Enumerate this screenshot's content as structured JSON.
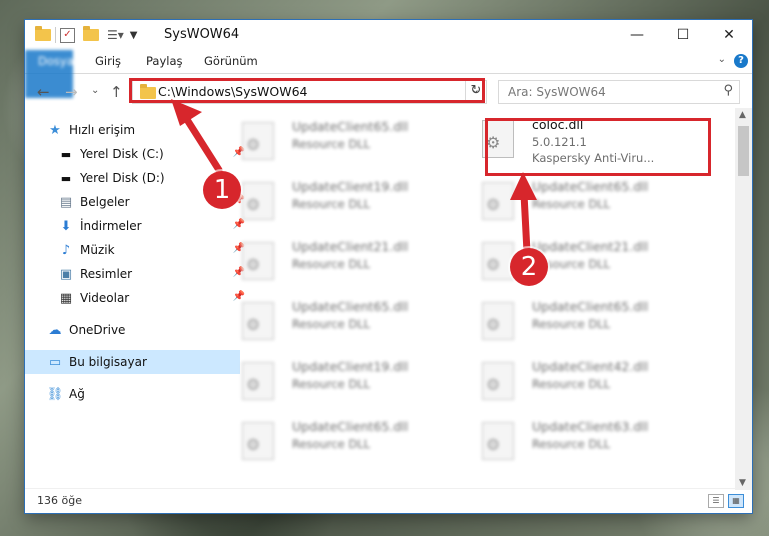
{
  "window": {
    "title": "SysWOW64",
    "controls": {
      "minimize": "—",
      "maximize": "☐",
      "close": "✕"
    }
  },
  "ribbon": {
    "tabs": [
      "Dosya",
      "Giriş",
      "Paylaş",
      "Görünüm"
    ],
    "help": "?"
  },
  "navigation": {
    "address": "C:\\Windows\\SysWOW64",
    "search_placeholder": "Ara: SysWOW64"
  },
  "sidebar": {
    "items": [
      {
        "label": "Hızlı erişim",
        "icon": "star-icon"
      },
      {
        "label": "Yerel Disk (C:)",
        "icon": "drive-icon"
      },
      {
        "label": "Yerel Disk (D:)",
        "icon": "drive-icon"
      },
      {
        "label": "Belgeler",
        "icon": "documents-icon"
      },
      {
        "label": "İndirmeler",
        "icon": "download-icon"
      },
      {
        "label": "Müzik",
        "icon": "music-icon"
      },
      {
        "label": "Resimler",
        "icon": "pictures-icon"
      },
      {
        "label": "Videolar",
        "icon": "video-icon"
      },
      {
        "label": "OneDrive",
        "icon": "cloud-icon"
      },
      {
        "label": "Bu bilgisayar",
        "icon": "computer-icon"
      },
      {
        "label": "Ağ",
        "icon": "network-icon"
      }
    ]
  },
  "files": {
    "highlighted": {
      "name": "coloc.dll",
      "version": "5.0.121.1",
      "company": "Kaspersky Anti-Viru..."
    },
    "left_column": [
      {
        "name": "UpdateClient65.dll",
        "type": "Resource DLL"
      },
      {
        "name": "UpdateClient19.dll",
        "type": "Resource DLL"
      },
      {
        "name": "UpdateClient21.dll",
        "type": "Resource DLL"
      },
      {
        "name": "UpdateClient65.dll",
        "type": "Resource DLL"
      },
      {
        "name": "UpdateClient19.dll",
        "type": "Resource DLL"
      },
      {
        "name": "UpdateClient65.dll",
        "type": "Resource DLL"
      }
    ],
    "right_column": [
      {
        "name": "UpdateClient65.dll",
        "type": "Resource DLL"
      },
      {
        "name": "UpdateClient21.dll",
        "type": "Resource DLL"
      },
      {
        "name": "UpdateClient65.dll",
        "type": "Resource DLL"
      },
      {
        "name": "UpdateClient42.dll",
        "type": "Resource DLL"
      },
      {
        "name": "UpdateClient63.dll",
        "type": "Resource DLL"
      }
    ]
  },
  "status": {
    "count": "136 öğe"
  },
  "annotations": {
    "badge1": "1",
    "badge2": "2",
    "color": "#d7262c"
  }
}
